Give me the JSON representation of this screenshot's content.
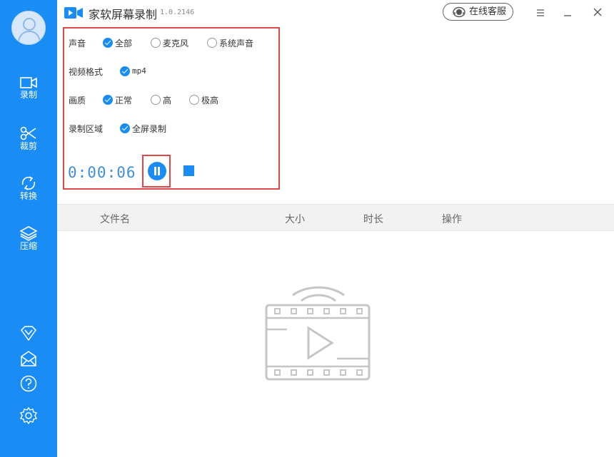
{
  "app": {
    "title": "家软屏幕录制",
    "version": "1.0.2146",
    "service_label": "在线客服"
  },
  "colors": {
    "brand": "#1a8cf5",
    "highlight_border": "#e04848",
    "timer": "#3f8ed8"
  },
  "sidebar": {
    "items": [
      {
        "label": "录制",
        "icon": "video-camera-icon"
      },
      {
        "label": "裁剪",
        "icon": "scissors-icon"
      },
      {
        "label": "转换",
        "icon": "convert-icon"
      },
      {
        "label": "压缩",
        "icon": "layers-icon"
      }
    ],
    "bottom_icons": [
      "vip-diamond-icon",
      "mail-icon",
      "help-icon",
      "settings-icon"
    ]
  },
  "settings": {
    "audio": {
      "label": "声音",
      "options": [
        {
          "label": "全部",
          "selected": true
        },
        {
          "label": "麦克风",
          "selected": false
        },
        {
          "label": "系统声音",
          "selected": false
        }
      ]
    },
    "format": {
      "label": "视频格式",
      "options": [
        {
          "label": "mp4",
          "selected": true
        }
      ]
    },
    "quality": {
      "label": "画质",
      "options": [
        {
          "label": "正常",
          "selected": true
        },
        {
          "label": "高",
          "selected": false
        },
        {
          "label": "极高",
          "selected": false
        }
      ]
    },
    "area": {
      "label": "录制区域",
      "options": [
        {
          "label": "全屏录制",
          "selected": true
        }
      ]
    }
  },
  "recording": {
    "timer": "0:00:06"
  },
  "table": {
    "columns": [
      "文件名",
      "大小",
      "时长",
      "操作"
    ]
  }
}
